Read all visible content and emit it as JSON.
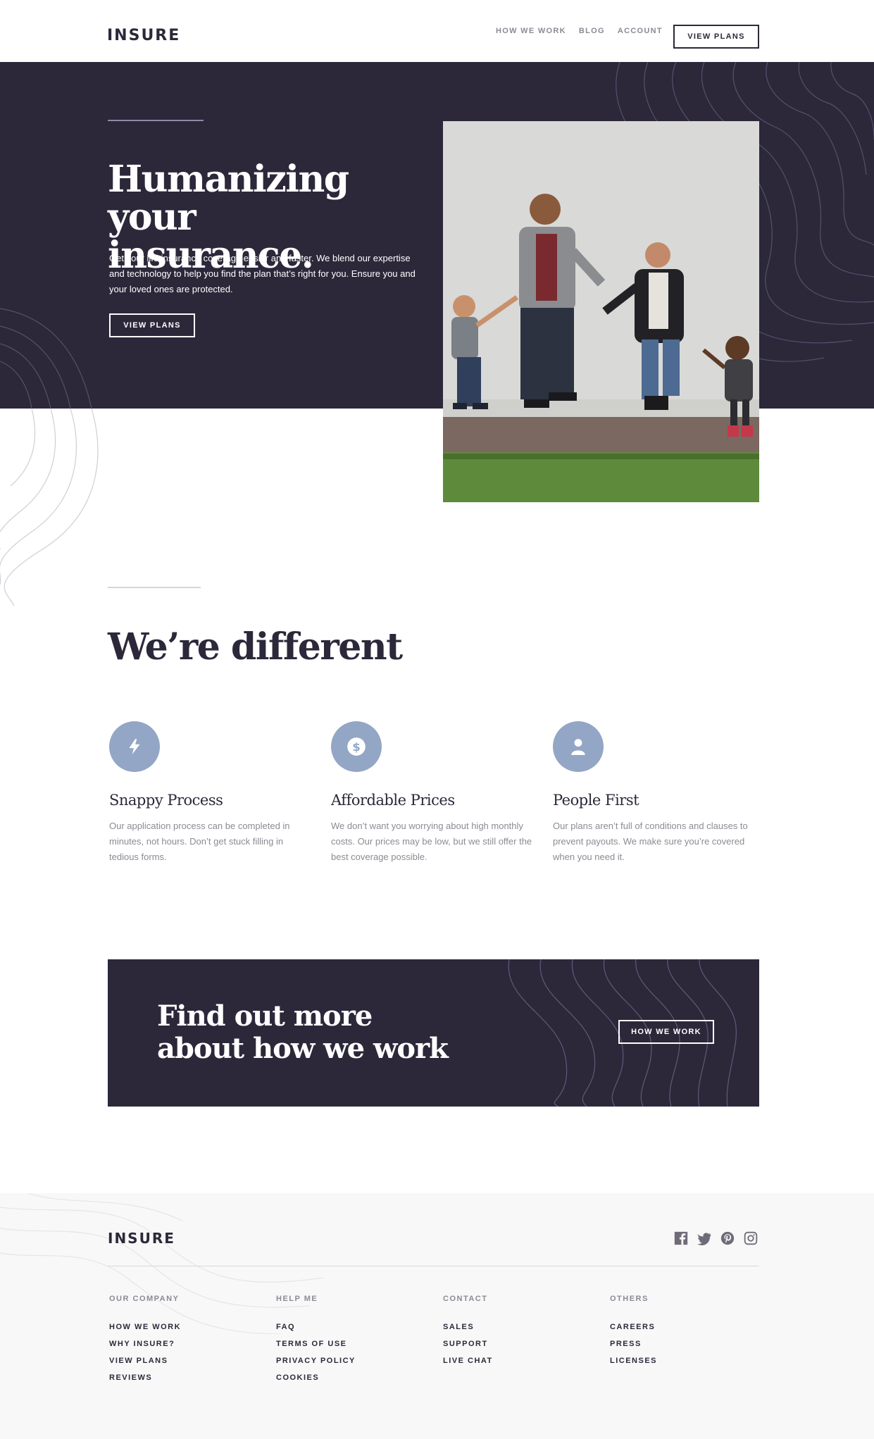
{
  "header": {
    "logo": "INSURE",
    "nav": [
      "HOW WE WORK",
      "BLOG",
      "ACCOUNT"
    ],
    "cta": "VIEW PLANS"
  },
  "hero": {
    "title_line1": "Humanizing",
    "title_line2": "your insurance.",
    "text": "Get your life insurance coverage easier and faster. We blend our expertise and technology to help you find the plan that’s right for you. Ensure you and your loved ones are protected.",
    "button": "VIEW PLANS",
    "photo_alt": "family walking hand in hand"
  },
  "different": {
    "title": "We’re different",
    "features": [
      {
        "icon": "lightning-icon",
        "title": "Snappy Process",
        "text": "Our application process can be completed in minutes, not hours. Don’t get stuck filling in tedious forms."
      },
      {
        "icon": "dollar-icon",
        "title": "Affordable Prices",
        "text": "We don’t want you worrying about high monthly costs. Our prices may be low, but we still offer the best coverage possible."
      },
      {
        "icon": "person-icon",
        "title": "People First",
        "text": "Our plans aren’t full of conditions and clauses to prevent payouts. We make sure you’re covered when you need it."
      }
    ]
  },
  "cta": {
    "title_line1": "Find out more",
    "title_line2": "about how we work",
    "button": "HOW WE WORK"
  },
  "footer": {
    "logo": "INSURE",
    "social": [
      "facebook-icon",
      "twitter-icon",
      "pinterest-icon",
      "instagram-icon"
    ],
    "columns": [
      {
        "heading": "OUR COMPANY",
        "links": [
          "HOW WE WORK",
          "WHY INSURE?",
          "VIEW PLANS",
          "REVIEWS"
        ]
      },
      {
        "heading": "HELP ME",
        "links": [
          "FAQ",
          "TERMS OF USE",
          "PRIVACY POLICY",
          "COOKIES"
        ]
      },
      {
        "heading": "CONTACT",
        "links": [
          "SALES",
          "SUPPORT",
          "LIVE CHAT"
        ]
      },
      {
        "heading": "OTHERS",
        "links": [
          "CAREERS",
          "PRESS",
          "LICENSES"
        ]
      }
    ]
  },
  "colors": {
    "dark": "#2c283a",
    "accent": "#93a6c5",
    "muted": "#8c8a94",
    "footer_bg": "#f8f8f8"
  }
}
